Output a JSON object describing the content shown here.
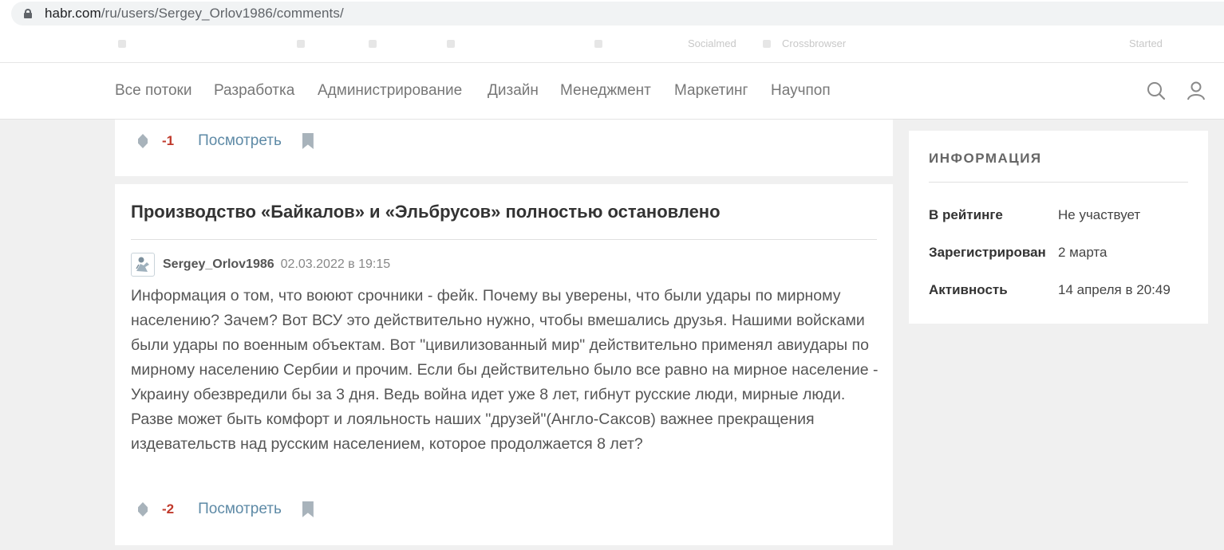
{
  "browser": {
    "url_host": "habr.com",
    "url_path": "/ru/users/Sergey_Orlov1986/comments/"
  },
  "bookmarks": {
    "items": [
      "Socialmed",
      "Crossbrowser",
      "Started"
    ]
  },
  "nav": {
    "items": [
      {
        "label": "Все потоки"
      },
      {
        "label": "Разработка"
      },
      {
        "label": "Администрирование"
      },
      {
        "label": "Дизайн"
      },
      {
        "label": "Менеджмент"
      },
      {
        "label": "Маркетинг"
      },
      {
        "label": "Научпоп"
      }
    ],
    "search_icon": "search-icon",
    "user_icon": "user-icon"
  },
  "comment_prev": {
    "score": "-1",
    "view_label": "Посмотреть"
  },
  "comment_main": {
    "post_title": "Производство «Байкалов» и «Эльбрусов» полностью остановлено",
    "author": "Sergey_Orlov1986",
    "date": "02.03.2022 в 19:15",
    "text": "Информация о том, что воюют срочники - фейк. Почему вы уверены, что были удары по мирному населению? Зачем? Вот ВСУ это действительно нужно, чтобы вмешались друзья. Нашими войсками были удары по военным объектам. Вот \"цивилизованный мир\" действительно применял авиудары по мирному населению Сербии и прочим. Если бы действительно было все равно на мирное население - Украину обезвредили бы за 3 дня. Ведь война идет уже 8 лет, гибнут русские люди, мирные люди. Разве может быть комфорт и лояльность наших \"друзей\"(Англо-Саксов) важнее прекращения издевательств над русским населением, которое продолжается 8 лет?",
    "score": "-2",
    "view_label": "Посмотреть"
  },
  "info": {
    "title": "ИНФОРМАЦИЯ",
    "rows": [
      {
        "label": "В рейтинге",
        "value": "Не участвует"
      },
      {
        "label": "Зарегистрирован",
        "value": "2 марта"
      },
      {
        "label": "Активность",
        "value": "14 апреля в 20:49"
      }
    ]
  },
  "colors": {
    "score_negative": "#c0392b",
    "link": "#5e8aa6",
    "icon_gray": "#a8b3bb",
    "page_bg": "#f0f0f0"
  }
}
